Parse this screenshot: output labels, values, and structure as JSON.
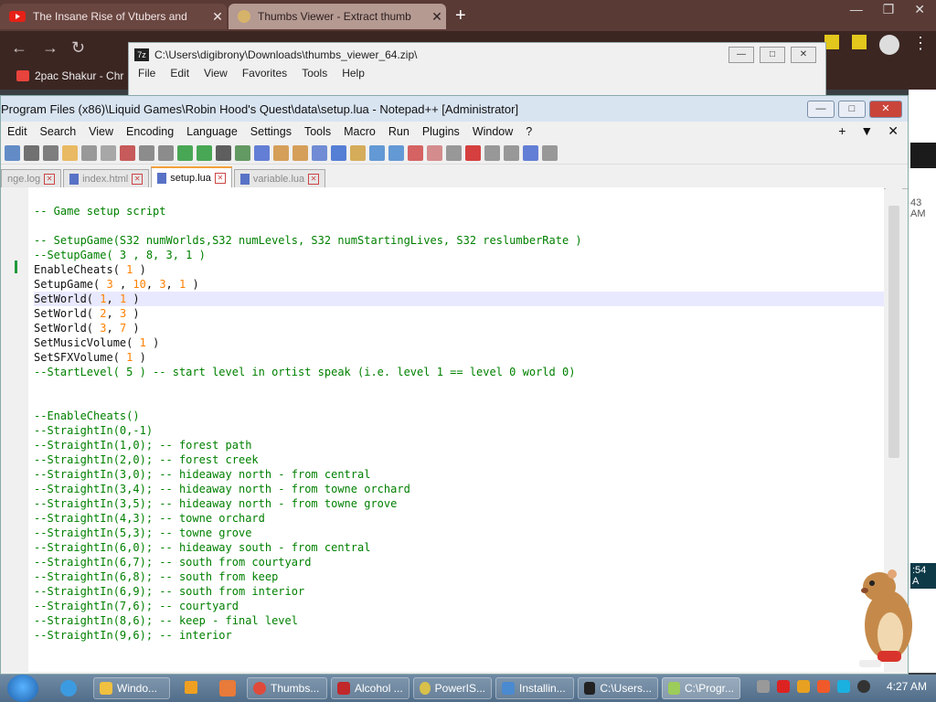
{
  "chrome": {
    "tab1": "The Insane Rise of Vtubers and",
    "tab2": "Thumbs Viewer - Extract thumb",
    "bookmark": "2pac Shakur - Chr"
  },
  "zip": {
    "path": "C:\\Users\\digibrony\\Downloads\\thumbs_viewer_64.zip\\",
    "menu": [
      "File",
      "Edit",
      "View",
      "Favorites",
      "Tools",
      "Help"
    ]
  },
  "npp": {
    "title": "Program Files (x86)\\Liquid Games\\Robin Hood's Quest\\data\\setup.lua - Notepad++ [Administrator]",
    "menu": [
      "Edit",
      "Search",
      "View",
      "Encoding",
      "Language",
      "Settings",
      "Tools",
      "Macro",
      "Run",
      "Plugins",
      "Window",
      "?"
    ],
    "tabs": [
      "nge.log",
      "index.html",
      "setup.lua",
      "variable.lua"
    ],
    "active_tab": "setup.lua"
  },
  "code_lines": [
    [
      [
        "cm",
        "-- Game setup script"
      ]
    ],
    [],
    [
      [
        "cm",
        "-- SetupGame(S32 numWorlds,S32 numLevels, S32 numStartingLives, S32 reslumberRate )"
      ]
    ],
    [
      [
        "cm",
        "--SetupGame( 3 , 8, 3, 1 )"
      ]
    ],
    [
      [
        "kw",
        "EnableCheats"
      ],
      [
        "p",
        "( "
      ],
      [
        "num",
        "1"
      ],
      [
        "p",
        " )"
      ]
    ],
    [
      [
        "kw",
        "SetupGame"
      ],
      [
        "p",
        "( "
      ],
      [
        "num",
        "3"
      ],
      [
        "p",
        " , "
      ],
      [
        "num",
        "10"
      ],
      [
        "p",
        ", "
      ],
      [
        "num",
        "3"
      ],
      [
        "p",
        ", "
      ],
      [
        "num",
        "1"
      ],
      [
        "p",
        " )"
      ]
    ],
    [
      [
        "kw",
        "SetWorld"
      ],
      [
        "p",
        "( "
      ],
      [
        "num",
        "1"
      ],
      [
        "p",
        ", "
      ],
      [
        "num",
        "1"
      ],
      [
        "p",
        " )"
      ]
    ],
    [
      [
        "kw",
        "SetWorld"
      ],
      [
        "p",
        "( "
      ],
      [
        "num",
        "2"
      ],
      [
        "p",
        ", "
      ],
      [
        "num",
        "3"
      ],
      [
        "p",
        " )"
      ]
    ],
    [
      [
        "kw",
        "SetWorld"
      ],
      [
        "p",
        "( "
      ],
      [
        "num",
        "3"
      ],
      [
        "p",
        ", "
      ],
      [
        "num",
        "7"
      ],
      [
        "p",
        " )"
      ]
    ],
    [
      [
        "kw",
        "SetMusicVolume"
      ],
      [
        "p",
        "( "
      ],
      [
        "num",
        "1"
      ],
      [
        "p",
        " )"
      ]
    ],
    [
      [
        "kw",
        "SetSFXVolume"
      ],
      [
        "p",
        "( "
      ],
      [
        "num",
        "1"
      ],
      [
        "p",
        " )"
      ]
    ],
    [
      [
        "cm",
        "--StartLevel( 5 ) -- start level in ortist speak (i.e. level 1 == level 0 world 0)"
      ]
    ],
    [],
    [],
    [
      [
        "cm",
        "--EnableCheats()"
      ]
    ],
    [
      [
        "cm",
        "--StraightIn(0,-1)"
      ]
    ],
    [
      [
        "cm",
        "--StraightIn(1,0); -- forest path"
      ]
    ],
    [
      [
        "cm",
        "--StraightIn(2,0); -- forest creek"
      ]
    ],
    [
      [
        "cm",
        "--StraightIn(3,0); -- hideaway north - from central"
      ]
    ],
    [
      [
        "cm",
        "--StraightIn(3,4); -- hideaway north - from towne orchard"
      ]
    ],
    [
      [
        "cm",
        "--StraightIn(3,5); -- hideaway north - from towne grove"
      ]
    ],
    [
      [
        "cm",
        "--StraightIn(4,3); -- towne orchard"
      ]
    ],
    [
      [
        "cm",
        "--StraightIn(5,3); -- towne grove"
      ]
    ],
    [
      [
        "cm",
        "--StraightIn(6,0); -- hideaway south - from central"
      ]
    ],
    [
      [
        "cm",
        "--StraightIn(6,7); -- south from courtyard"
      ]
    ],
    [
      [
        "cm",
        "--StraightIn(6,8); -- south from keep"
      ]
    ],
    [
      [
        "cm",
        "--StraightIn(6,9); -- south from interior"
      ]
    ],
    [
      [
        "cm",
        "--StraightIn(7,6); -- courtyard"
      ]
    ],
    [
      [
        "cm",
        "--StraightIn(8,6); -- keep - final level"
      ]
    ],
    [
      [
        "cm",
        "--StraightIn(9,6); -- interior"
      ]
    ]
  ],
  "highlight_line": 6,
  "background": {
    "text1": "43 AM",
    "text2": ":54 A"
  },
  "taskbar": {
    "items": [
      "Windo...",
      "Thumbs...",
      "Alcohol ...",
      "PowerIS...",
      "Installin...",
      "C:\\Users...",
      "C:\\Progr..."
    ],
    "clock": "4:27 AM"
  }
}
